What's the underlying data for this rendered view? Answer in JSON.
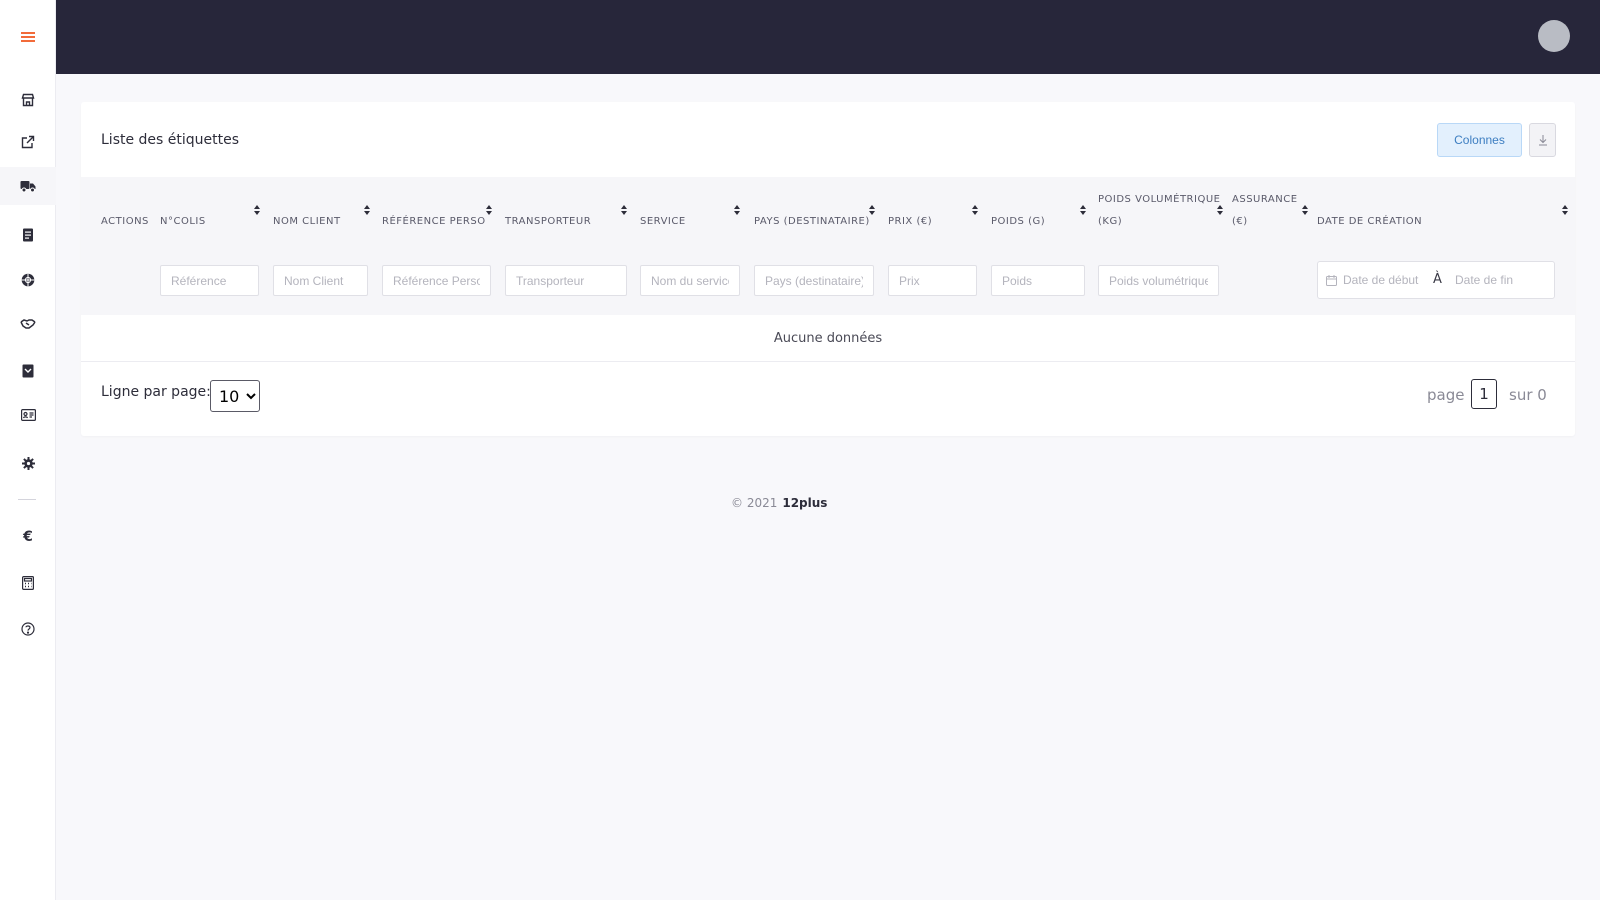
{
  "sidebar": {
    "items": [
      {
        "icon": "store-icon",
        "label": ""
      },
      {
        "icon": "external-link-icon",
        "label": ""
      },
      {
        "icon": "truck-icon",
        "label": ""
      },
      {
        "icon": "document-icon",
        "label": ""
      },
      {
        "icon": "globe-icon",
        "label": ""
      },
      {
        "icon": "handshake-icon",
        "label": ""
      },
      {
        "icon": "archive-icon",
        "label": ""
      },
      {
        "icon": "id-card-icon",
        "label": ""
      },
      {
        "icon": "gear-icon",
        "label": ""
      },
      {
        "icon": "euro-icon",
        "label": "€"
      },
      {
        "icon": "calculator-icon",
        "label": ""
      },
      {
        "icon": "help-icon",
        "label": ""
      }
    ],
    "active_index": 2,
    "accent_color": "#f26b3a"
  },
  "topbar": {
    "background": "#27263a"
  },
  "card": {
    "title": "Liste des étiquettes",
    "columns_button": "Colonnes"
  },
  "table": {
    "headers": {
      "actions": "Actions",
      "colis": "N°Colis",
      "nom_client": "Nom client",
      "reference_perso": "Référence perso",
      "transporteur": "Transporteur",
      "service": "Service",
      "pays": "Pays (destinataire)",
      "prix": "Prix (€)",
      "poids": "Poids (g)",
      "poids_vol_line1": "Poids volumétrique",
      "poids_vol_line2": "(kg)",
      "assurance_line1": "Assurance",
      "assurance_line2": "(€)",
      "date_creation": "Date de création"
    },
    "filters": {
      "reference": "Référence",
      "nom_client": "Nom Client",
      "reference_perso": "Référence Perso",
      "transporteur": "Transporteur",
      "service": "Nom du service",
      "pays": "Pays (destinataire)",
      "prix": "Prix",
      "poids": "Poids",
      "poids_vol": "Poids volumétrique",
      "date_debut": "Date de début",
      "date_sep": "À",
      "date_fin": "Date de fin"
    },
    "empty_message": "Aucune données"
  },
  "pagination": {
    "rows_label": "Ligne par page:",
    "rows_value": "10",
    "rows_options": [
      "10"
    ],
    "page_label": "page",
    "current_page": "1",
    "of_label": "sur 0"
  },
  "footer": {
    "copyright": "© 2021",
    "brand": "12plus"
  }
}
